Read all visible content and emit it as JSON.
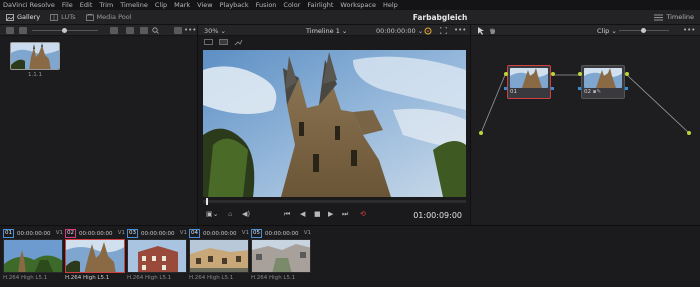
{
  "menubar": {
    "items": [
      "DaVinci Resolve",
      "File",
      "Edit",
      "Trim",
      "Timeline",
      "Clip",
      "Mark",
      "View",
      "Playback",
      "Fusion",
      "Color",
      "Fairlight",
      "Workspace",
      "Help"
    ]
  },
  "toolbar": {
    "gallery_label": "Gallery",
    "luts_label": "LUTs",
    "media_pool_label": "Media Pool",
    "page_title": "Farbabgleich",
    "timeline_label": "Timeline"
  },
  "gallery": {
    "still_label": "1.1.1"
  },
  "viewer": {
    "zoom": "30%",
    "timeline_name": "Timeline 1",
    "timecode": "00:00:00:00",
    "playhead_timecode": "01:00:09:00"
  },
  "nodes": {
    "clip_mode": "Clip",
    "node1_label": "01",
    "node2_label": "02"
  },
  "clips": [
    {
      "num": "01",
      "timecode": "00:00:00:00",
      "track": "V1",
      "codec": "H.264 High L5.1",
      "selected": false
    },
    {
      "num": "02",
      "timecode": "00:00:00:00",
      "track": "V1",
      "codec": "H.264 High L5.1",
      "selected": true
    },
    {
      "num": "03",
      "timecode": "00:00:00:00",
      "track": "V1",
      "codec": "H.264 High L5.1",
      "selected": false
    },
    {
      "num": "04",
      "timecode": "00:00:00:00",
      "track": "V1",
      "codec": "H.264 High L5.1",
      "selected": false
    },
    {
      "num": "05",
      "timecode": "00:00:00:00",
      "track": "V1",
      "codec": "H.264 High L5.1",
      "selected": false
    }
  ],
  "colors": {
    "accent_red": "#d04040",
    "node_link": "#b8d83a",
    "clip_num_border": "#4a90d8"
  }
}
